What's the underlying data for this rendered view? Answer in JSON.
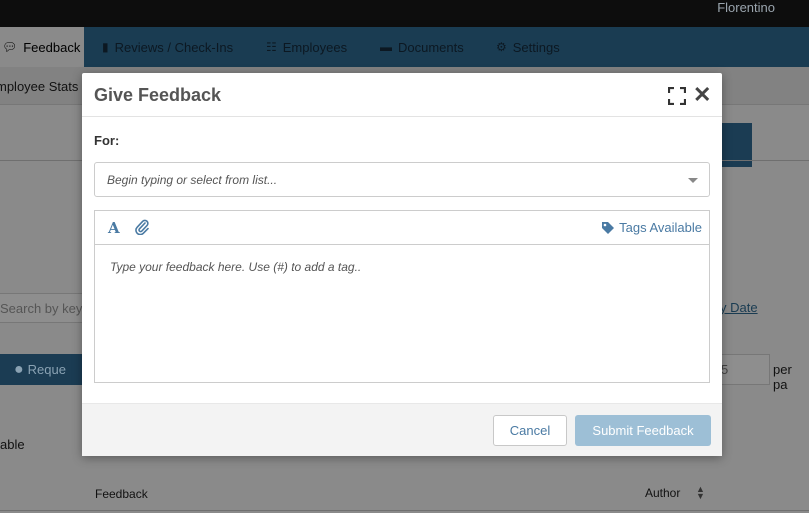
{
  "topbar": {
    "user_name": "Florentino"
  },
  "nav": {
    "items": [
      {
        "label": "Feedback",
        "icon": "comment-icon"
      },
      {
        "label": "Reviews / Check-Ins",
        "icon": "document-icon"
      },
      {
        "label": "Employees",
        "icon": "org-chart-icon"
      },
      {
        "label": "Documents",
        "icon": "folder-icon"
      },
      {
        "label": "Settings",
        "icon": "gear-icon"
      }
    ]
  },
  "subnav": {
    "tab_label": "mployee Stats"
  },
  "background": {
    "search_placeholder": "Search by key",
    "sort_link": "y Date",
    "request_button": "Reque",
    "per_page_value": "5",
    "per_page_label": "per pa",
    "section_text": "able",
    "table_headers": {
      "feedback": "Feedback",
      "author": "Author"
    }
  },
  "modal": {
    "title": "Give Feedback",
    "for_label": "For:",
    "recipient_placeholder": "Begin typing or select from list...",
    "tags_label": "Tags Available",
    "feedback_placeholder": "Type your feedback here. Use (#) to add a tag..",
    "cancel_label": "Cancel",
    "submit_label": "Submit Feedback",
    "colors": {
      "accent": "#4a7aa3",
      "submit_bg": "#9dbfd6",
      "nav_bg": "#1a3c52"
    }
  }
}
